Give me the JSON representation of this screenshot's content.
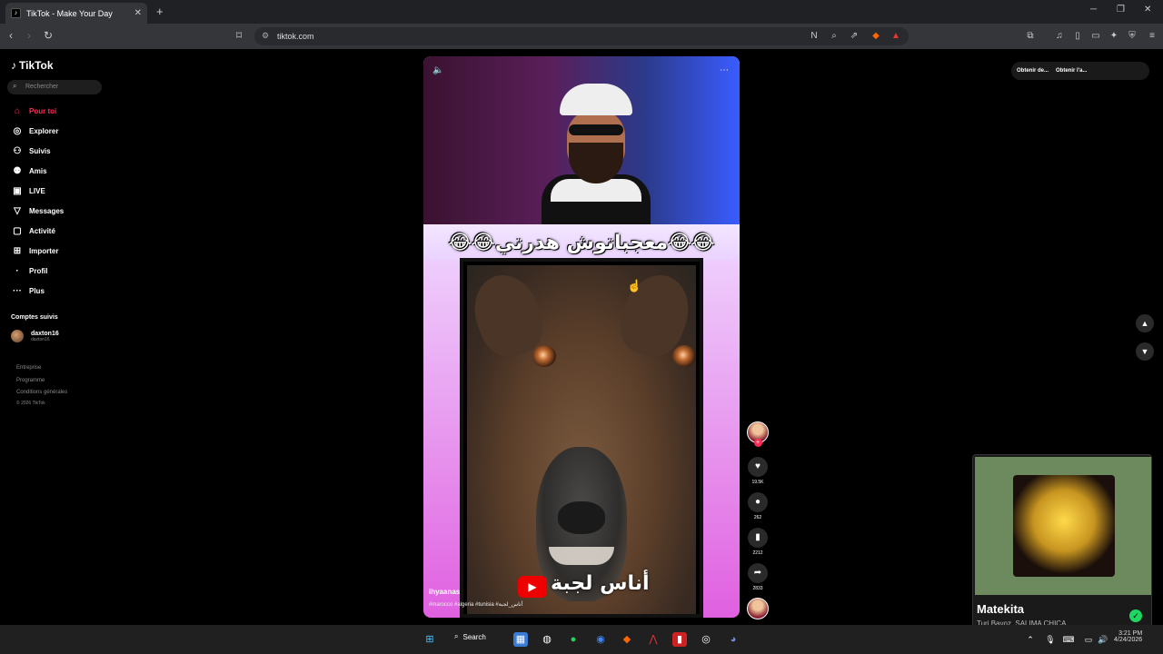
{
  "browser": {
    "tab_title": "TikTok - Make Your Day",
    "url": "tiktok.com"
  },
  "sidebar": {
    "logo": "TikTok",
    "search_placeholder": "Rechercher",
    "nav": [
      {
        "label": "Pour toi",
        "icon": "home-icon"
      },
      {
        "label": "Explorer",
        "icon": "compass-icon"
      },
      {
        "label": "Suivis",
        "icon": "user-follow-icon"
      },
      {
        "label": "Amis",
        "icon": "friends-icon"
      },
      {
        "label": "LIVE",
        "icon": "live-icon"
      },
      {
        "label": "Messages",
        "icon": "message-icon"
      },
      {
        "label": "Activité",
        "icon": "activity-icon"
      },
      {
        "label": "Importer",
        "icon": "upload-icon"
      },
      {
        "label": "Profil",
        "icon": "profile-icon"
      },
      {
        "label": "Plus",
        "icon": "more-icon"
      }
    ],
    "following_title": "Comptes suivis",
    "following": [
      {
        "name": "daxton16",
        "handle": "daxton16"
      }
    ],
    "footer": [
      "Entreprise",
      "Programme",
      "Conditions générales",
      "© 2026 TikTok"
    ]
  },
  "video": {
    "caption_top": "😂😂معجباتوش هدرتي😂😂",
    "caption_bottom": "أناس لجبة",
    "username": "ihyaanas",
    "hashtags": "#marocco #algeria #tunisia #أناس_لجبة",
    "likes": "19.5K",
    "comments": "262",
    "saves": "2212",
    "shares": "2833"
  },
  "topbar": {
    "btn1": "Obtenir de...",
    "btn2": "Obtenir l'a..."
  },
  "music": {
    "title": "Matekita",
    "artist": "Turi Bayoz, SALIMA CHICA"
  },
  "taskbar": {
    "search": "Search",
    "time": "3:21 PM",
    "date": "4/24/2026"
  }
}
